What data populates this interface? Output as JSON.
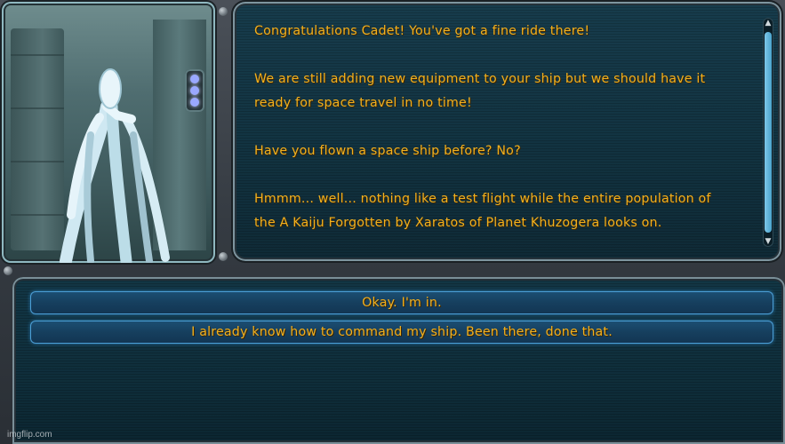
{
  "dialog": {
    "lines": [
      "Congratulations Cadet! You've got a fine ride there!",
      "We are still adding new equipment to your ship but we should have it",
      "ready for space travel in no time!",
      "Have you flown a space ship before? No?",
      "Hmmm... well... nothing like a test flight while the entire population of",
      "the A Kaiju Forgotten by Xaratos of Planet Khuzogera looks on."
    ]
  },
  "responses": {
    "options": [
      "Okay. I'm in.",
      "I already know how to command my ship. Been there, done that."
    ]
  },
  "watermark": "imgflip.com",
  "colors": {
    "text": "#f2b01e",
    "dialog_bg": "#133847",
    "option_border": "#4c9fd6"
  }
}
